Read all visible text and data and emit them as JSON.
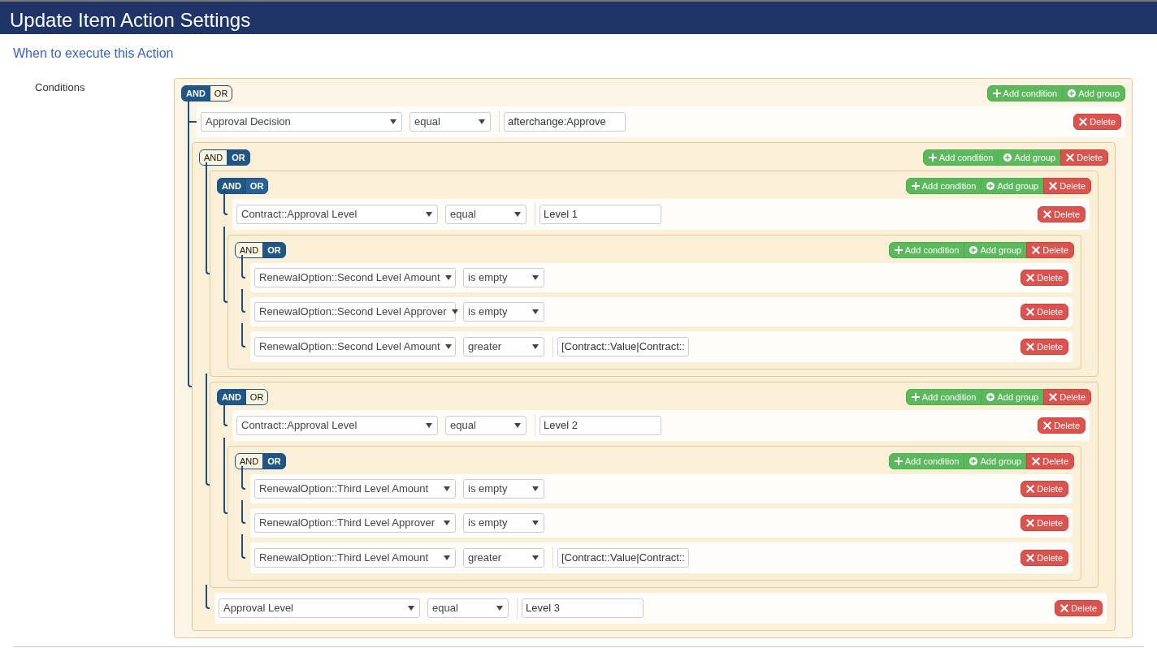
{
  "dialog": {
    "title": "Update Item Action Settings"
  },
  "section_title": "When to execute this Action",
  "conditions_label": "Conditions",
  "root": {
    "logic": [
      {
        "label": "AND",
        "selected": true
      },
      {
        "label": "OR",
        "selected": false
      }
    ],
    "actions": [
      {
        "kind": "add_condition",
        "label": "Add condition"
      },
      {
        "kind": "add_group",
        "label": "Add group"
      }
    ],
    "children": [
      {
        "kind": "rule",
        "field": "Approval Decision",
        "operator": "equal",
        "value": "afterchange:Approve",
        "delete": "Delete"
      },
      {
        "kind": "group",
        "logic": [
          {
            "label": "AND",
            "selected": false
          },
          {
            "label": "OR",
            "selected": true
          }
        ],
        "actions": [
          {
            "kind": "add_condition",
            "label": "Add condition"
          },
          {
            "kind": "add_group",
            "label": "Add group"
          },
          {
            "kind": "delete",
            "label": "Delete"
          }
        ],
        "children": [
          {
            "kind": "group",
            "logic": [
              {
                "label": "AND",
                "selected": true
              },
              {
                "label": "OR",
                "selected": false,
                "hovered": true
              }
            ],
            "actions": [
              {
                "kind": "add_condition",
                "label": "Add condition"
              },
              {
                "kind": "add_group",
                "label": "Add group"
              },
              {
                "kind": "delete",
                "label": "Delete"
              }
            ],
            "children": [
              {
                "kind": "rule",
                "field": "Contract::Approval Level",
                "operator": "equal",
                "value": "Level 1",
                "delete": "Delete"
              },
              {
                "kind": "group",
                "logic": [
                  {
                    "label": "AND",
                    "selected": false
                  },
                  {
                    "label": "OR",
                    "selected": true
                  }
                ],
                "actions": [
                  {
                    "kind": "add_condition",
                    "label": "Add condition"
                  },
                  {
                    "kind": "add_group",
                    "label": "Add group"
                  },
                  {
                    "kind": "delete",
                    "label": "Delete"
                  }
                ],
                "children": [
                  {
                    "kind": "rule",
                    "field": "RenewalOption::Second Level Amount",
                    "operator": "is empty",
                    "delete": "Delete"
                  },
                  {
                    "kind": "rule",
                    "field": "RenewalOption::Second Level Approver",
                    "operator": "is empty",
                    "delete": "Delete"
                  },
                  {
                    "kind": "rule",
                    "field": "RenewalOption::Second Level Amount",
                    "operator": "greater",
                    "value": "[Contract::Value|Contract::",
                    "delete": "Delete"
                  }
                ]
              }
            ]
          },
          {
            "kind": "group",
            "logic": [
              {
                "label": "AND",
                "selected": true
              },
              {
                "label": "OR",
                "selected": false
              }
            ],
            "actions": [
              {
                "kind": "add_condition",
                "label": "Add condition"
              },
              {
                "kind": "add_group",
                "label": "Add group"
              },
              {
                "kind": "delete",
                "label": "Delete"
              }
            ],
            "children": [
              {
                "kind": "rule",
                "field": "Contract::Approval Level",
                "operator": "equal",
                "value": "Level 2",
                "delete": "Delete"
              },
              {
                "kind": "group",
                "logic": [
                  {
                    "label": "AND",
                    "selected": false
                  },
                  {
                    "label": "OR",
                    "selected": true
                  }
                ],
                "actions": [
                  {
                    "kind": "add_condition",
                    "label": "Add condition"
                  },
                  {
                    "kind": "add_group",
                    "label": "Add group"
                  },
                  {
                    "kind": "delete",
                    "label": "Delete"
                  }
                ],
                "children": [
                  {
                    "kind": "rule",
                    "field": "RenewalOption::Third Level Amount",
                    "operator": "is empty",
                    "delete": "Delete"
                  },
                  {
                    "kind": "rule",
                    "field": "RenewalOption::Third Level Approver",
                    "operator": "is empty",
                    "delete": "Delete"
                  },
                  {
                    "kind": "rule",
                    "field": "RenewalOption::Third Level Amount",
                    "operator": "greater",
                    "value": "[Contract::Value|Contract::",
                    "delete": "Delete"
                  }
                ]
              }
            ]
          },
          {
            "kind": "rule",
            "field": "Approval Level",
            "operator": "equal",
            "value": "Level 3",
            "delete": "Delete"
          }
        ]
      }
    ]
  }
}
